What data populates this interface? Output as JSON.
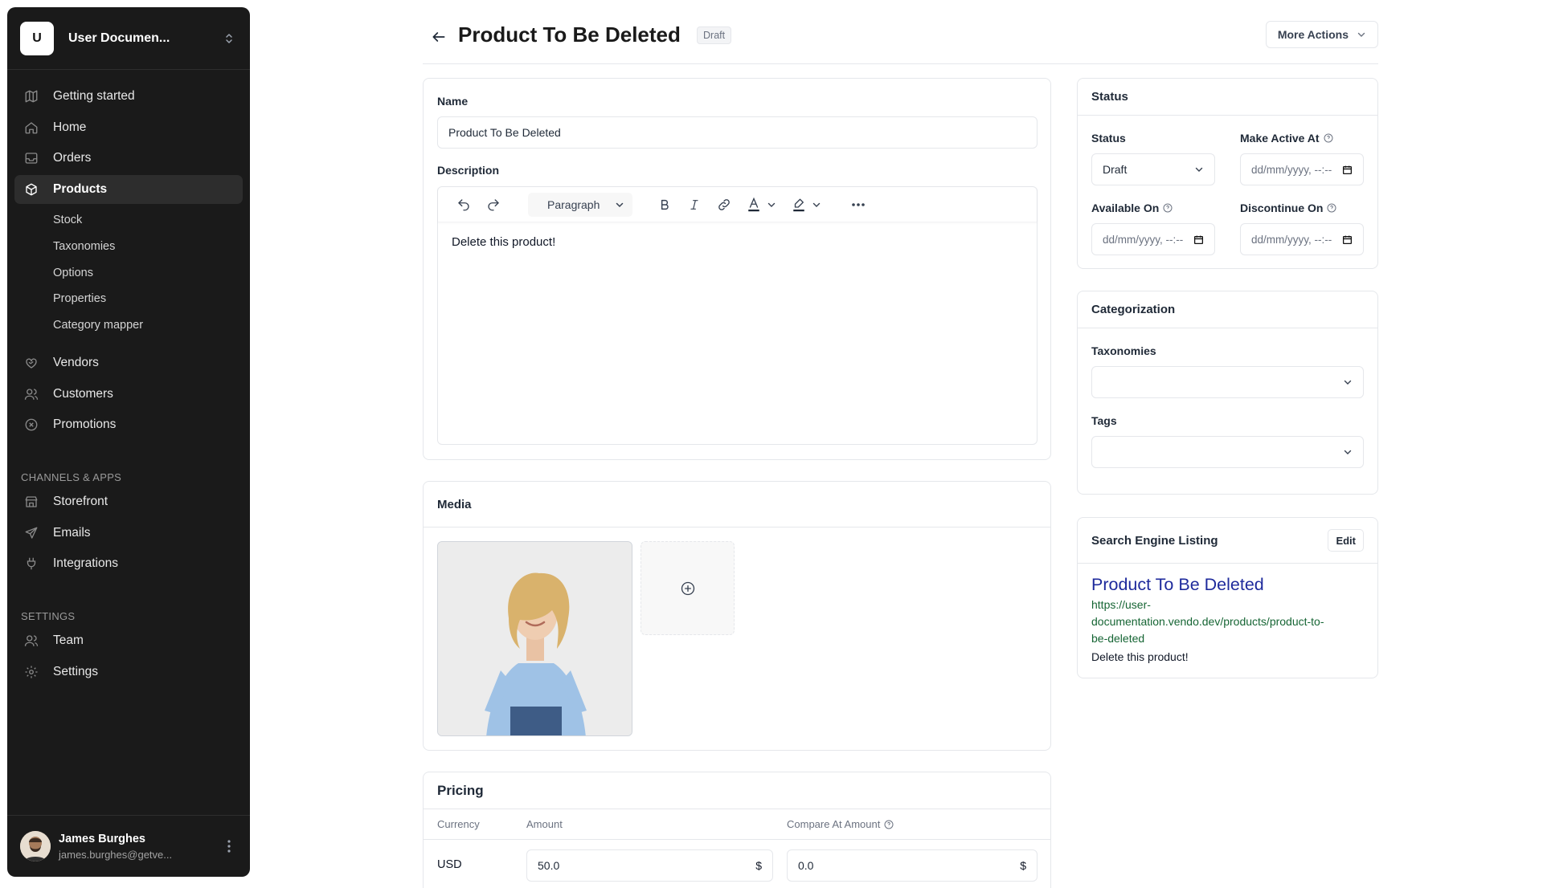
{
  "sidebar": {
    "org_initial": "U",
    "org_name": "User Documen...",
    "nav": [
      {
        "label": "Getting started",
        "icon": "map-icon"
      },
      {
        "label": "Home",
        "icon": "home-icon"
      },
      {
        "label": "Orders",
        "icon": "inbox-icon"
      },
      {
        "label": "Products",
        "icon": "box-icon",
        "active": true
      }
    ],
    "product_subitems": [
      "Stock",
      "Taxonomies",
      "Options",
      "Properties",
      "Category mapper"
    ],
    "nav2": [
      {
        "label": "Vendors",
        "icon": "handshake-icon"
      },
      {
        "label": "Customers",
        "icon": "users-icon"
      },
      {
        "label": "Promotions",
        "icon": "discount-icon"
      }
    ],
    "channels_heading": "CHANNELS & APPS",
    "channels": [
      {
        "label": "Storefront",
        "icon": "store-icon"
      },
      {
        "label": "Emails",
        "icon": "send-icon"
      },
      {
        "label": "Integrations",
        "icon": "plug-icon"
      }
    ],
    "settings_heading": "SETTINGS",
    "settings": [
      {
        "label": "Team",
        "icon": "users-icon"
      },
      {
        "label": "Settings",
        "icon": "gear-icon"
      }
    ],
    "user": {
      "name": "James Burghes",
      "email": "james.burghes@getve..."
    }
  },
  "header": {
    "title": "Product To Be Deleted",
    "badge": "Draft",
    "more_actions": "More Actions"
  },
  "details": {
    "name_label": "Name",
    "name_value": "Product To Be Deleted",
    "description_label": "Description",
    "format_select": "Paragraph",
    "description_text": "Delete this product!"
  },
  "media": {
    "title": "Media"
  },
  "pricing": {
    "title": "Pricing",
    "col_currency": "Currency",
    "col_amount": "Amount",
    "col_compare": "Compare At Amount",
    "rows": [
      {
        "currency": "USD",
        "amount": "50.0",
        "compare": "0.0",
        "symbol": "$"
      }
    ]
  },
  "status_card": {
    "title": "Status",
    "status_label": "Status",
    "status_value": "Draft",
    "make_active_label": "Make Active At",
    "available_label": "Available On",
    "discontinue_label": "Discontinue On",
    "date_placeholder": "dd/mm/yyyy, --:--"
  },
  "categorization": {
    "title": "Categorization",
    "taxonomies_label": "Taxonomies",
    "tags_label": "Tags"
  },
  "seo": {
    "title": "Search Engine Listing",
    "edit_label": "Edit",
    "listing_title": "Product To Be Deleted",
    "url": "https://user-documentation.vendo.dev/products/product-to-be-deleted",
    "url_lines": [
      "https://user-",
      "documentation.vendo.dev/products/product-to-",
      "be-deleted"
    ],
    "description": "Delete this product!"
  }
}
